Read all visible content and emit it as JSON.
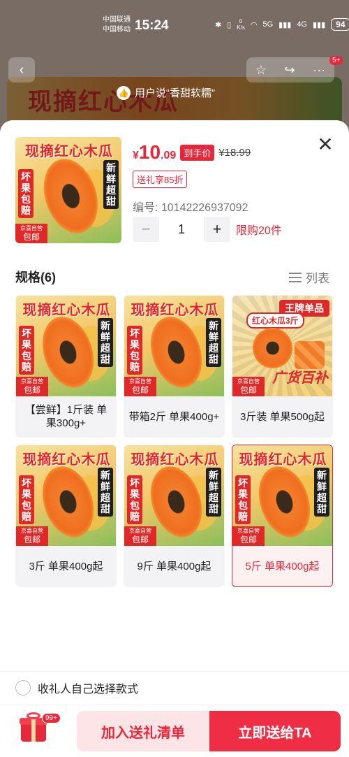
{
  "status_bar": {
    "carrier1": "中国联通",
    "carrier2": "中国移动",
    "time": "15:24",
    "net_speed": "0\nK/s",
    "signal1": "5G",
    "signal2": "4G",
    "battery": "94"
  },
  "background": {
    "hero_text": "现摘红心木瓜",
    "tip": "用户说“香甜软糯”",
    "nav_badge": "5+"
  },
  "product": {
    "currency": "¥",
    "price_int": "10",
    "price_dec": ".09",
    "price_tag": "到手价",
    "original_price": "¥18.99",
    "gift_tag": "送礼享85折",
    "code": "编号: 10142226937092",
    "quantity": "1",
    "limit": "限购20件",
    "image": {
      "title": "现摘红心木瓜",
      "left_tag": "坏果包赔",
      "right_tag": "新鲜超甜",
      "jd_small": "京喜自营",
      "jd_big": "包邮"
    }
  },
  "spec": {
    "heading": "规格(6)",
    "list_label": "列表",
    "items": [
      {
        "label": "【尝鲜】1斤装 单果300g+",
        "selected": false
      },
      {
        "label": "带箱2斤 单果400g+",
        "selected": false
      },
      {
        "label": "3斤装 单果500g起",
        "selected": false,
        "alt_image": {
          "brand": "王牌单品",
          "badge": "红心木瓜3斤",
          "big": "广货百补"
        }
      },
      {
        "label": "3斤 单果400g起",
        "selected": false
      },
      {
        "label": "9斤 单果400g起",
        "selected": false
      },
      {
        "label": "5斤 单果400g起",
        "selected": true
      }
    ]
  },
  "choose_label": "收礼人自己选择款式",
  "bottom": {
    "badge": "99+",
    "add_label": "加入送礼清单",
    "send_label": "立即送给TA"
  },
  "colors": {
    "accent": "#e8283a",
    "accent_light": "#fde5e7"
  }
}
